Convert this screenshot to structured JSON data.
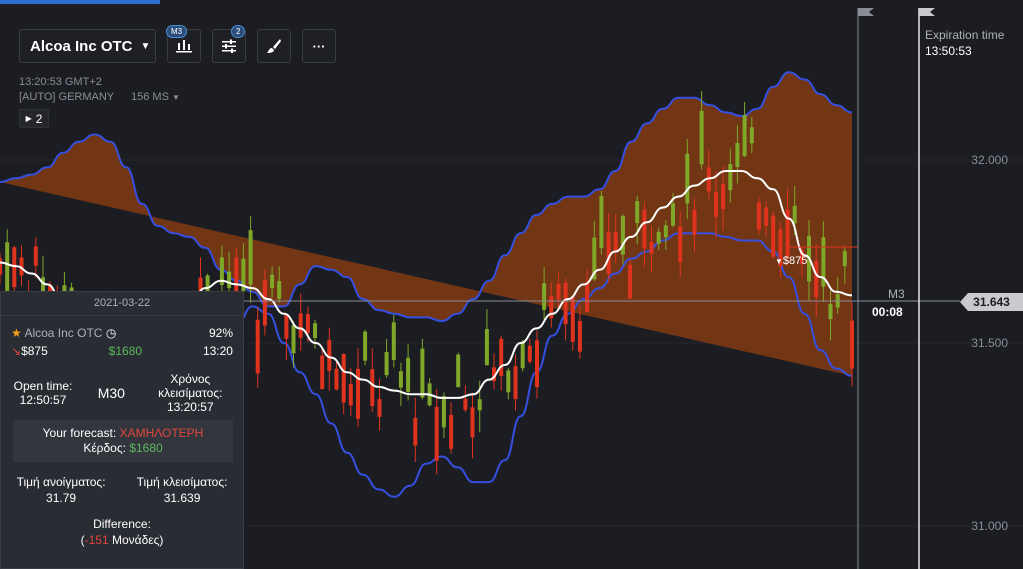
{
  "header": {
    "asset": "Alcoa Inc OTC",
    "timeframe_badge": "M3",
    "indicators_badge": "2",
    "more_label": "···"
  },
  "info": {
    "time": "13:20:53 GMT+2",
    "server": "[AUTO] GERMANY",
    "latency": "156 MS",
    "trades_count": "2"
  },
  "expiration": {
    "label": "Expiration time",
    "time": "13:50:53"
  },
  "axis": {
    "ticks": [
      "32.000",
      "31.500",
      "31.000"
    ]
  },
  "current": {
    "price": "31.643",
    "timeframe": "M3",
    "countdown": "00:08"
  },
  "trade_marker": {
    "label": "$875"
  },
  "trade_panel": {
    "date": "2021-03-22",
    "asset": "Alcoa Inc OTC",
    "payout": "92%",
    "amount": "$875",
    "profit": "$1680",
    "close_hour": "13:20",
    "open_time_label": "Open time:",
    "open_time": "12:50:57",
    "period": "M30",
    "close_time_label": "Χρόνος κλεισίματος:",
    "close_time": "13:20:57",
    "forecast_label": "Your forecast:",
    "forecast_value": "ΧΑΜΗΛΟΤΕΡΗ",
    "profit_label": "Κέρδος:",
    "open_price_label": "Τιμή ανοίγματος:",
    "open_price": "31.79",
    "close_price_label": "Τιμή κλεισίματος:",
    "close_price": "31.639",
    "difference_label": "Difference:",
    "difference_value": "-151",
    "difference_unit": "Μονάδες)"
  },
  "colors": {
    "background": "#1c1d22",
    "band_fill": "#8a3e12",
    "band_line": "#3550e0",
    "ma_line": "#ffffff",
    "up_candle": "#7fa82a",
    "down_candle": "#e0331e",
    "green_text": "#5cb85c",
    "red_text": "#e0463b"
  },
  "chart_data": {
    "type": "line",
    "ylim": [
      30.9,
      32.25
    ],
    "series": [
      {
        "values": [
          31.72,
          31.71,
          31.69,
          31.66,
          31.61,
          31.55,
          31.46,
          31.37,
          31.33,
          31.35,
          31.4,
          31.5,
          31.6,
          31.65,
          31.67,
          31.66,
          31.65,
          31.62,
          31.58,
          31.54,
          31.5,
          31.46,
          31.42,
          31.4,
          31.38,
          31.37,
          31.36,
          31.36,
          31.35,
          31.35,
          31.36,
          31.4,
          31.44,
          31.5,
          31.54,
          31.58,
          31.62,
          31.66,
          31.7,
          31.75,
          31.79,
          31.83,
          31.87,
          31.9,
          31.93,
          31.95,
          31.97,
          31.97,
          31.95,
          31.92,
          31.84,
          31.74,
          31.68,
          31.64,
          31.63
        ]
      },
      {
        "values": [
          31.94,
          31.95,
          31.96,
          31.98,
          32.02,
          32.05,
          32.07,
          32.05,
          31.98,
          31.88,
          31.82,
          31.8,
          31.79,
          31.76,
          31.7,
          31.67,
          31.64,
          31.6,
          31.6,
          31.66,
          31.71,
          31.7,
          31.68,
          31.62,
          31.59,
          31.58,
          31.57,
          31.57,
          31.56,
          31.58,
          31.62,
          31.67,
          31.74,
          31.8,
          31.85,
          31.88,
          31.9,
          31.9,
          31.92,
          31.97,
          32.05,
          32.1,
          32.14,
          32.17,
          32.17,
          32.15,
          32.13,
          32.12,
          32.14,
          32.2,
          32.24,
          32.22,
          32.18,
          32.15,
          32.13
        ]
      },
      {
        "values": [
          31.5,
          31.45,
          31.4,
          31.3,
          31.18,
          31.05,
          30.94,
          30.92,
          30.93,
          30.98,
          31.05,
          31.13,
          31.22,
          31.32,
          31.44,
          31.55,
          31.6,
          31.58,
          31.5,
          31.42,
          31.36,
          31.28,
          31.2,
          31.14,
          31.1,
          31.08,
          31.11,
          31.17,
          31.19,
          31.16,
          31.12,
          31.12,
          31.18,
          31.3,
          31.42,
          31.52,
          31.58,
          31.62,
          31.65,
          31.69,
          31.73,
          31.75,
          31.78,
          31.8,
          31.8,
          31.8,
          31.79,
          31.78,
          31.78,
          31.75,
          31.68,
          31.58,
          31.48,
          31.43,
          31.41
        ]
      }
    ]
  }
}
